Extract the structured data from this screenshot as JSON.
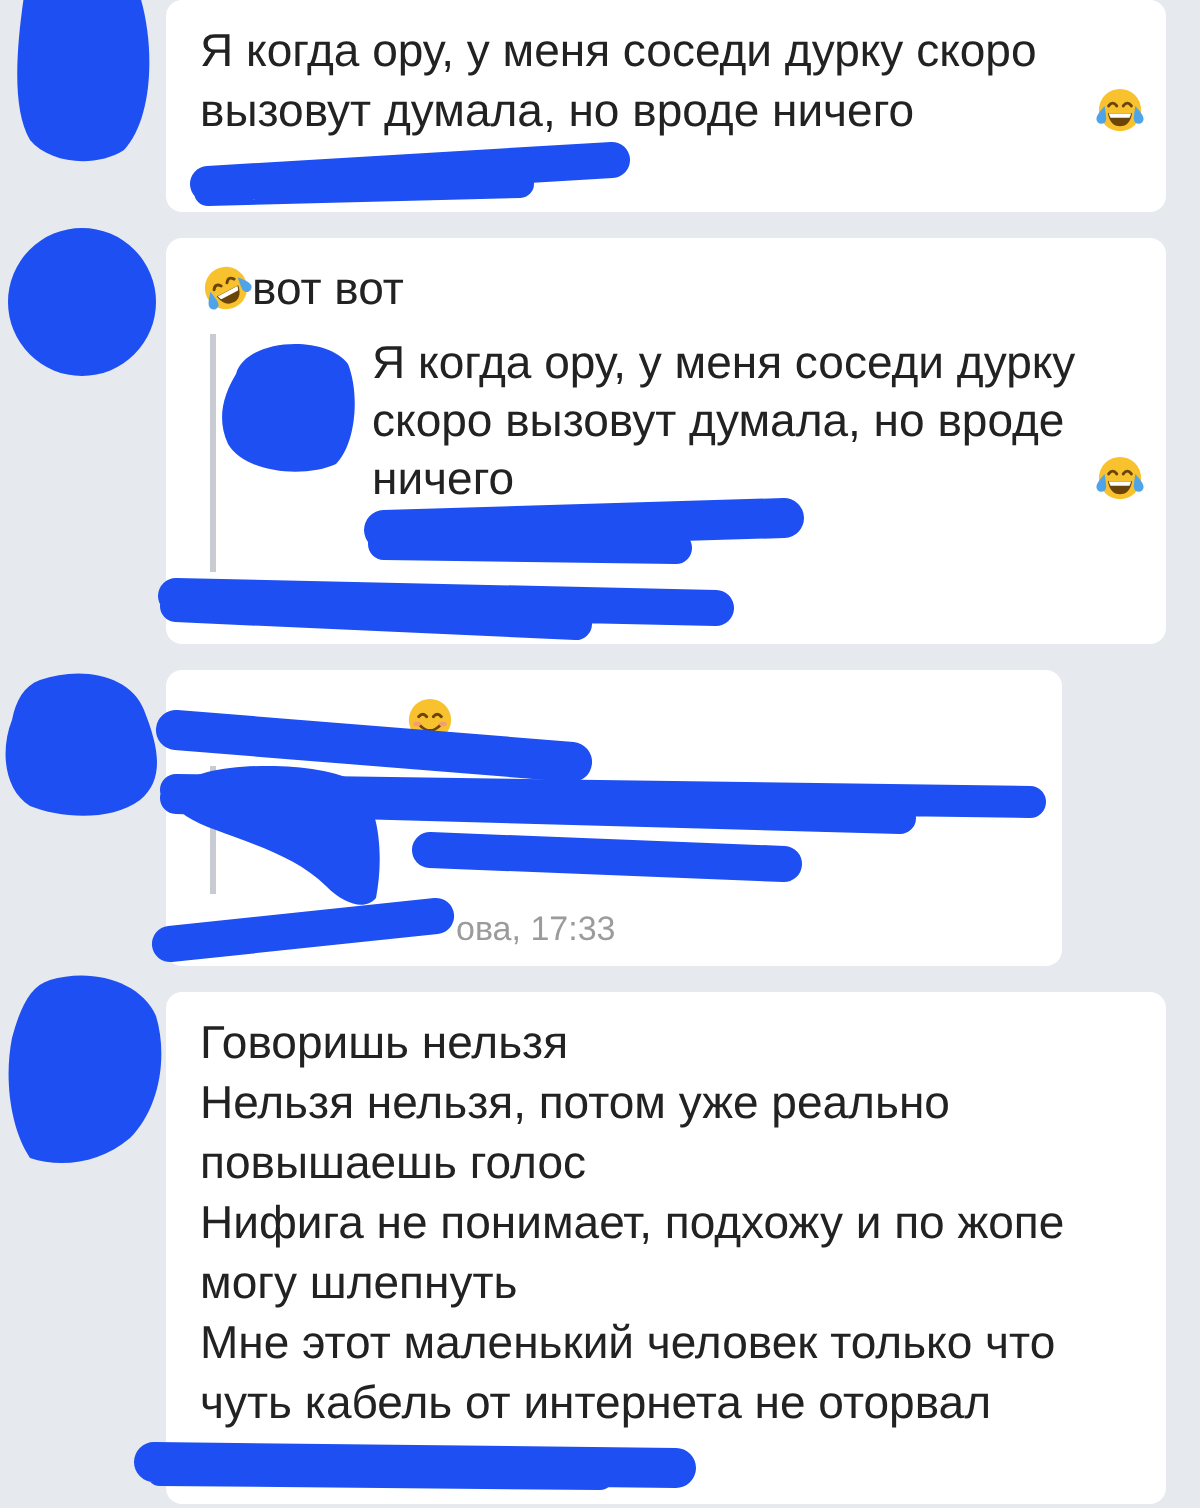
{
  "messages": [
    {
      "avatar_redacted": true,
      "body": "Я когда ору, у меня соседи дурку скоро вызовут думала, но вроде ничего",
      "trailing_emoji": {
        "kind": "tears-of-joy"
      },
      "meta_redacted": true
    },
    {
      "avatar_redacted": true,
      "leading_emoji": {
        "kind": "rolling-laughing"
      },
      "body": "вот вот",
      "quote": {
        "avatar_redacted": true,
        "body": "Я когда ору, у меня соседи дурку скоро вызовут думала, но вроде ничего",
        "trailing_emoji": {
          "kind": "tears-of-joy"
        },
        "meta_redacted": true
      },
      "meta_redacted": true
    },
    {
      "avatar_redacted": true,
      "body_redacted": true,
      "trailing_emoji": {
        "kind": "smiling"
      },
      "quote": {
        "avatar_redacted": true,
        "body_redacted": true,
        "meta_redacted": true
      },
      "meta_redacted": true,
      "meta": "ова, 17:33"
    },
    {
      "avatar_redacted": true,
      "body": "Говоришь нельзя\nНельзя нельзя, потом уже реально повышаешь голос\nНифига не понимает, подхожу и по жопе могу шлепнуть\nМне этот маленький человек только что чуть кабель от интернета не оторвал",
      "meta_redacted": true
    }
  ]
}
